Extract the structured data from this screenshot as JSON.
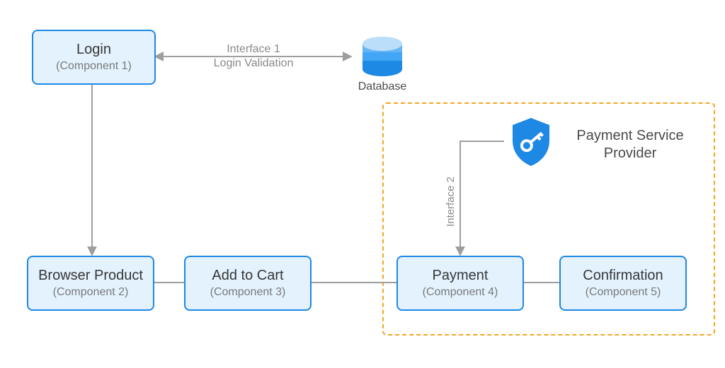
{
  "components": {
    "login": {
      "title": "Login",
      "subtitle": "(Component 1)"
    },
    "browser": {
      "title": "Browser Product",
      "subtitle": "(Component 2)"
    },
    "cart": {
      "title": "Add to Cart",
      "subtitle": "(Component 3)"
    },
    "payment": {
      "title": "Payment",
      "subtitle": "(Component 4)"
    },
    "confirm": {
      "title": "Confirmation",
      "subtitle": "(Component 5)"
    }
  },
  "labels": {
    "interface1_line1": "Interface 1",
    "interface1_line2": "Login Validation",
    "interface2": "Interface 2",
    "database": "Database",
    "psp_line1": "Payment Service",
    "psp_line2": "Provider"
  },
  "colors": {
    "box_border": "#1e88e5",
    "box_fill": "#e3f2fd",
    "arrow": "#9e9e9e",
    "dashed": "#f5a623",
    "db_top": "#bbdefb",
    "db_mid": "#64b5f6",
    "db_bot": "#1e88e5",
    "shield": "#1e88e5"
  }
}
